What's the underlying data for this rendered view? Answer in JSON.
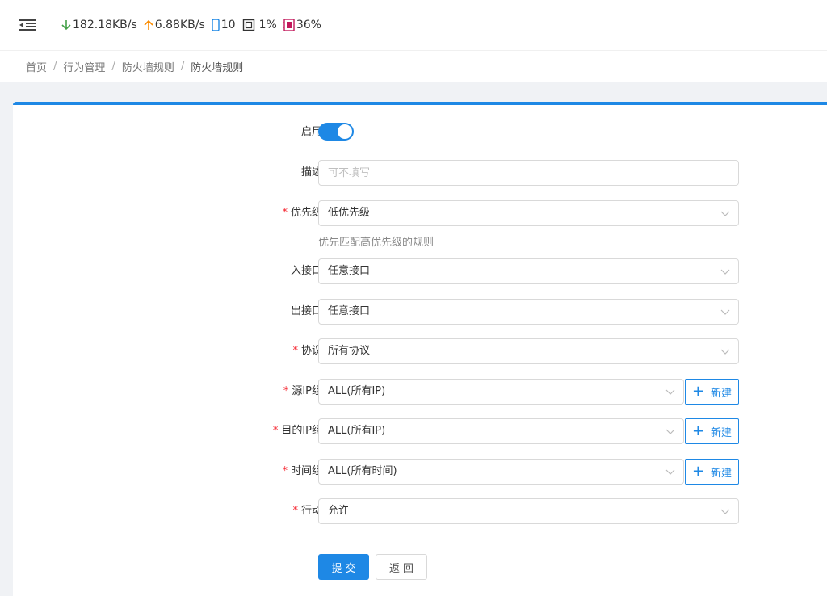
{
  "topbar": {
    "download_speed": "182.18KB/s",
    "upload_speed": "6.88KB/s",
    "device_count": "10",
    "cpu_usage": "1%",
    "memory_usage": "36%",
    "colors": {
      "download": "#43a047",
      "upload": "#fb8c00",
      "device": "#1e88e5",
      "memory": "#c2185b"
    }
  },
  "breadcrumb": [
    "首页",
    "行为管理",
    "防火墙规则",
    "防火墙规则"
  ],
  "form": {
    "enable": {
      "label": "启用",
      "value": true
    },
    "description": {
      "label": "描述",
      "placeholder": "可不填写",
      "value": ""
    },
    "priority": {
      "label": "优先级",
      "value": "低优先级",
      "hint": "优先匹配高优先级的规则",
      "required": true
    },
    "in_interface": {
      "label": "入接口",
      "value": "任意接口"
    },
    "out_interface": {
      "label": "出接口",
      "value": "任意接口"
    },
    "protocol": {
      "label": "协议",
      "value": "所有协议",
      "required": true
    },
    "src_ip_group": {
      "label": "源IP组",
      "value": "ALL(所有IP)",
      "required": true,
      "add_label": "新建"
    },
    "dst_ip_group": {
      "label": "目的IP组",
      "value": "ALL(所有IP)",
      "required": true,
      "add_label": "新建"
    },
    "time_group": {
      "label": "时间组",
      "value": "ALL(所有时间)",
      "required": true,
      "add_label": "新建"
    },
    "action": {
      "label": "行动",
      "value": "允许",
      "required": true
    },
    "submit_label": "提交",
    "back_label": "返回"
  },
  "required_mark": "*",
  "accent_color": "#1e88e5"
}
